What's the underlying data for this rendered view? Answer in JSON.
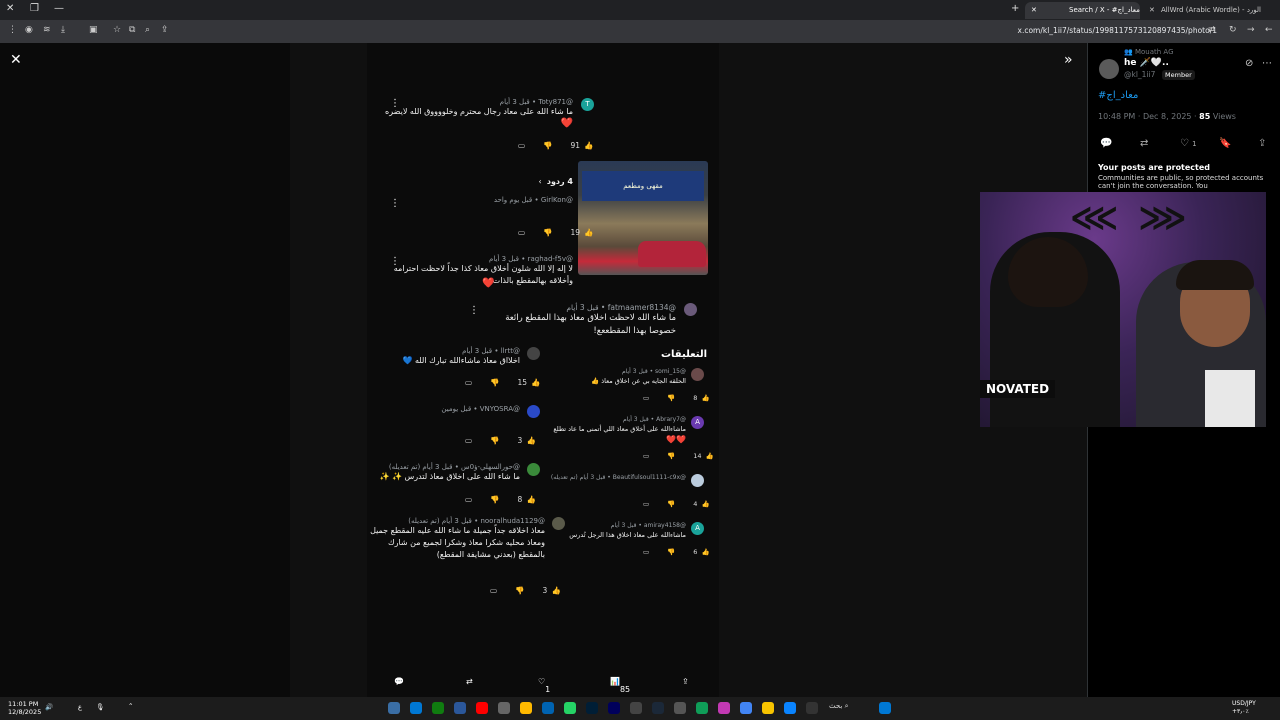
{
  "browser": {
    "tabs": [
      {
        "label": "Search / X - #معاد_اج",
        "active": true
      },
      {
        "label": "AllWrd (Arabic Wordle) - الورد",
        "active": false
      }
    ],
    "url": "x.com/kl_1ii7/status/1998117573120897435/photo/1"
  },
  "photo": {
    "comments_top": [
      {
        "user": "@Toty871 • قبل 3 أيام",
        "text": "ما شاء الله على معاد رجال محترم وخلووووق الله لايضره",
        "emoji": "❤️",
        "likes": "91",
        "avatar": "T"
      },
      {
        "replies_label": "4 ردود",
        "user": "@GirlKon • قبل يوم واحد",
        "likes": "19"
      },
      {
        "user": "@raghad-f5v • قبل 3 أيام",
        "text": "لا إله إلا الله شلون أخلاق معاذ كذا جداً لاحظت احترامه وأخلاقه بهالمقطع بالذات",
        "emoji": "❤️"
      }
    ],
    "main_comment": {
      "user": "@fatmaamer8134 • قبل 3 أيام",
      "text": "ما شاء الله لاحظت اخلاق معاذ بهذا المقطع رائعة خصوصا بهذا المقطععع!"
    },
    "comments_left": [
      {
        "user": "@llrtt • قبل 3 أيام",
        "text": "اخلااق معاذ ماشاءالله تبارك الله",
        "emoji": "💙",
        "likes": "15"
      },
      {
        "user": "@VNYOSRA • قبل يومين",
        "likes": "3"
      },
      {
        "user": "@حورالسهلي-ؤ0س • قبل 3 أيام (تم تعديله)",
        "text": "ما شاء الله على اخلاق معاذ لتدرس",
        "emoji": "✨ ✨",
        "likes": "8"
      },
      {
        "user": "@nooralhuda1129 • قبل 3 أيام (تم تعديله)",
        "text": "معاذ اخلاقه جداً جميلة ما شاء الله عليه المقطع جميل ومعاذ محليه شكرا معاذ وشكرا لجميع من شارك بالمقطع (بعدني مشايفة المقطع)",
        "likes": "3"
      }
    ],
    "comments_section_title": "التعليقات",
    "comments_right": [
      {
        "user": "@somi_15 • قبل 3 أيام",
        "text": "الحلقه الجايه بي عن اخلاق معاذ",
        "emoji": "👍",
        "likes": "8"
      },
      {
        "user": "@Abrary7 • قبل 3 أيام",
        "text": "ماشاءالله على أخلاق معاذ اللي أتمنى ما عاد تطلع",
        "emoji": "❤️❤️",
        "likes": "14",
        "avatar": "A"
      },
      {
        "user": "@Beautifulsoul1111-c9x • قبل 3 أيام (تم تعديله)",
        "likes": "4"
      },
      {
        "user": "@amiray4158 • قبل 3 أيام",
        "text": "ماشاءالله على معاذ اخلاق هذا الرجل تُدرس",
        "likes": "6",
        "avatar": "A"
      }
    ],
    "cafe_sign": "مقهى ومطعم"
  },
  "bottom_bar": {
    "reply": "",
    "retweet": "",
    "likes": "1",
    "views": "85",
    "share": ""
  },
  "right_panel": {
    "community_label": "Mouath AG",
    "name": "he 🗡️🤍..",
    "handle": "@kl_1ii7",
    "member_badge": "Member",
    "hashtag": "#معاد_اج",
    "time": "10:48 PM · Dec 8, 2025 · ",
    "views_count": "85",
    "views_label": " Views",
    "like_count": "1",
    "protected_title": "Your posts are protected",
    "protected_desc": "Communities are public, so protected accounts can't join the conversation. You"
  },
  "webcam": {
    "banner": "NOVATED"
  },
  "taskbar": {
    "time": "11:01 PM",
    "date": "12/8/2025",
    "search": "بحث",
    "lang": "USD/JPY",
    "lang_sub": "+٣٫٠٪"
  }
}
